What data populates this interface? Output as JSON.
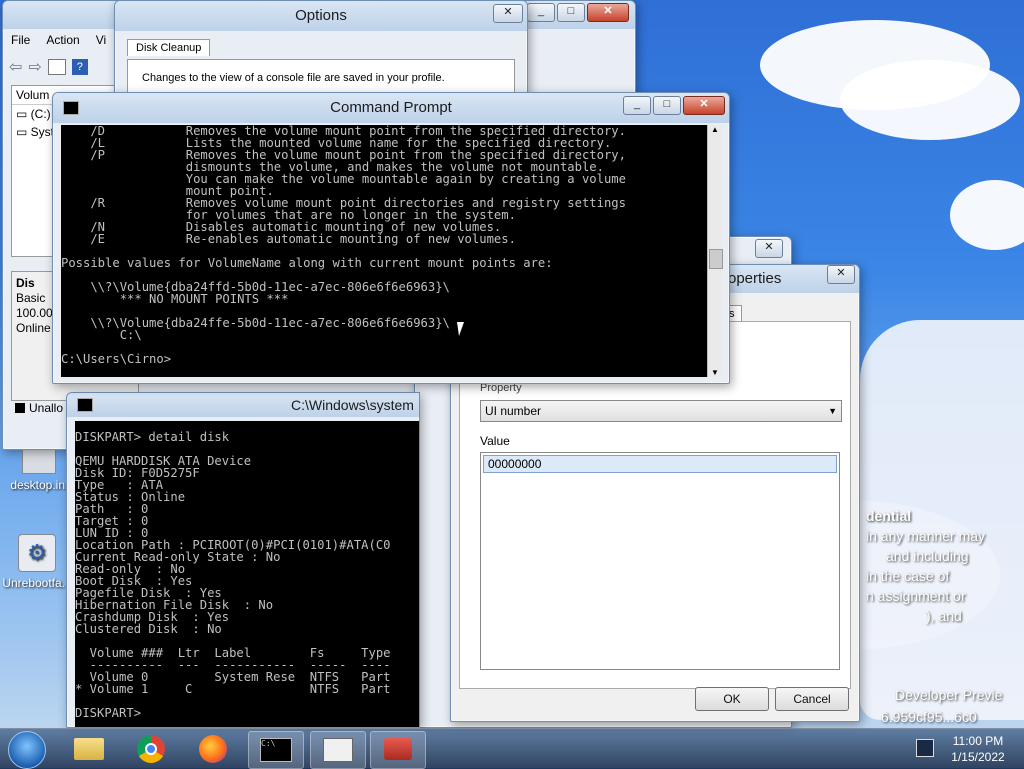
{
  "mmc_window": {
    "menu": [
      "File",
      "Action",
      "Vi"
    ],
    "column_header": "Volum",
    "rows": [
      "(C:)",
      "Syst"
    ],
    "disk_label": "Dis",
    "disk_info": [
      "Basic",
      "100.00",
      "Online"
    ],
    "legend_unallocated": "Unallo"
  },
  "options_dialog": {
    "title": "Options",
    "tab": "Disk Cleanup",
    "text": "Changes to the view of a console file are saved in your profile."
  },
  "cmd_prompt": {
    "title": "Command Prompt",
    "lines": [
      "    /D           Removes the volume mount point from the specified directory.",
      "    /L           Lists the mounted volume name for the specified directory.",
      "    /P           Removes the volume mount point from the specified directory,",
      "                 dismounts the volume, and makes the volume not mountable.",
      "                 You can make the volume mountable again by creating a volume",
      "                 mount point.",
      "    /R           Removes volume mount point directories and registry settings",
      "                 for volumes that are no longer in the system.",
      "    /N           Disables automatic mounting of new volumes.",
      "    /E           Re-enables automatic mounting of new volumes.",
      "",
      "Possible values for VolumeName along with current mount points are:",
      "",
      "    \\\\?\\Volume{dba24ffd-5b0d-11ec-a7ec-806e6f6e6963}\\",
      "        *** NO MOUNT POINTS ***",
      "",
      "    \\\\?\\Volume{dba24ffe-5b0d-11ec-a7ec-806e6f6e6963}\\",
      "        C:\\",
      "",
      "C:\\Users\\Cirno>"
    ]
  },
  "diskpart": {
    "title": "C:\\Windows\\system",
    "lines": [
      "DISKPART> detail disk",
      "",
      "QEMU HARDDISK ATA Device",
      "Disk ID: F0D5275F",
      "Type   : ATA",
      "Status : Online",
      "Path   : 0",
      "Target : 0",
      "LUN ID : 0",
      "Location Path : PCIROOT(0)#PCI(0101)#ATA(C0",
      "Current Read-only State : No",
      "Read-only  : No",
      "Boot Disk  : Yes",
      "Pagefile Disk  : Yes",
      "Hibernation File Disk  : No",
      "Crashdump Disk  : Yes",
      "Clustered Disk  : No",
      "",
      "  Volume ###  Ltr  Label        Fs     Type",
      "  ----------  ---  -----------  -----  ----",
      "  Volume 0         System Rese  NTFS   Part",
      "* Volume 1     C                NTFS   Part",
      "",
      "DISKPART>"
    ]
  },
  "small_dialog": {
    "close": "✕"
  },
  "properties_dialog": {
    "title": "roperties",
    "tab_fragment": "ts",
    "property_label": "Property",
    "property_value": "UI number",
    "value_label": "Value",
    "value_text": "00000000",
    "ok": "OK",
    "cancel": "Cancel"
  },
  "desktop_icons": [
    {
      "label": "desktop.ini",
      "icon": "settings-file-icon"
    },
    {
      "label": "Unrebootfa...",
      "icon": "gear-icon"
    }
  ],
  "wallpaper_text": [
    "dential",
    "in any manner may",
    "and including",
    "in the case of",
    "n assignment or",
    "), and",
    "Developer Previe",
    "6.959cf95...6c0"
  ],
  "taskbar": {
    "items": [
      "start-orb",
      "file-explorer",
      "chrome",
      "firefox",
      "cmd",
      "mmc",
      "toolbox"
    ],
    "time": "11:00 PM",
    "date": "1/15/2022"
  },
  "colors": {
    "console_bg": "#000000",
    "console_fg": "#c0c0c0",
    "close_red": "#c7422b"
  }
}
